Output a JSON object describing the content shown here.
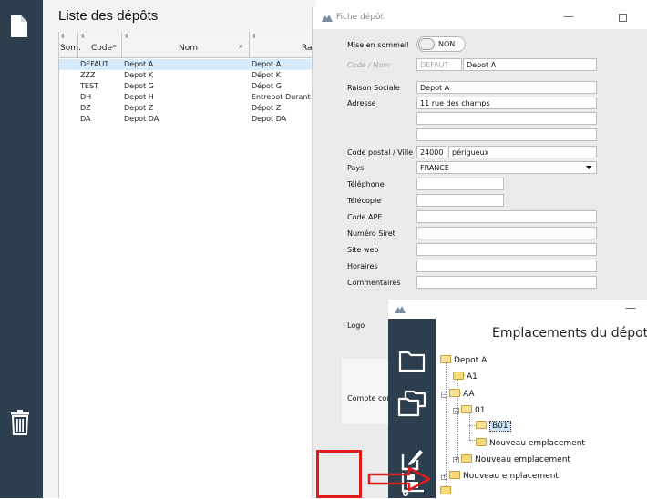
{
  "left_rail": {
    "top_icon": "document-icon",
    "bottom_icon": "trash-icon"
  },
  "list": {
    "title": "Liste des dépôts",
    "columns": [
      "Som.",
      "Code",
      "Nom",
      "Rais"
    ],
    "rows": [
      {
        "code": "DEFAUT",
        "nom": "Depot A",
        "raison": "Depot A",
        "selected": true
      },
      {
        "code": "ZZZ",
        "nom": "Depot K",
        "raison": "Dépot K",
        "selected": false
      },
      {
        "code": "TEST",
        "nom": "Depot G",
        "raison": "Dépot G",
        "selected": false
      },
      {
        "code": "DH",
        "nom": "Depot H",
        "raison": "Entrepot Durant B",
        "selected": false
      },
      {
        "code": "DZ",
        "nom": "Depot Z",
        "raison": "Dépot Z",
        "selected": false
      },
      {
        "code": "DA",
        "nom": "Depot DA",
        "raison": "Depot DA",
        "selected": false
      }
    ]
  },
  "fiche": {
    "title": "Fiche dépôt",
    "mise_en_sommeil_label": "Mise en sommeil",
    "toggle_text": "NON",
    "code_nom_label": "Code / Nom",
    "code_value": "DEFAUT",
    "nom_value": "Depot A",
    "raison_label": "Raison Sociale",
    "raison_value": "Depot A",
    "adresse_label": "Adresse",
    "adresse_value": "11 rue des champs",
    "cp_ville_label": "Code postal / Ville",
    "cp_value": "24000",
    "ville_value": "périgueux",
    "pays_label": "Pays",
    "pays_value": "FRANCE",
    "telephone_label": "Téléphone",
    "telecopie_label": "Télécopie",
    "code_ape_label": "Code APE",
    "siret_label": "Numéro Siret",
    "site_label": "Site web",
    "horaires_label": "Horaires",
    "commentaires_label": "Commentaires",
    "logo_label": "Logo",
    "compte_label": "Compte com"
  },
  "emplacements": {
    "heading": "Emplacements du dépot :",
    "toolbar_icons": [
      "folder-icon",
      "copy-icon",
      "edit-icon",
      "warehouse-icon"
    ],
    "tree": {
      "root": "Depot A",
      "a1": "A1",
      "aa": "AA",
      "n01": "01",
      "b01": "B01",
      "new1": "Nouveau emplacement",
      "new2": "Nouveau emplacement",
      "new3": "Nouveau emplacement"
    }
  },
  "annotation": {
    "color": "#e01b1b"
  }
}
